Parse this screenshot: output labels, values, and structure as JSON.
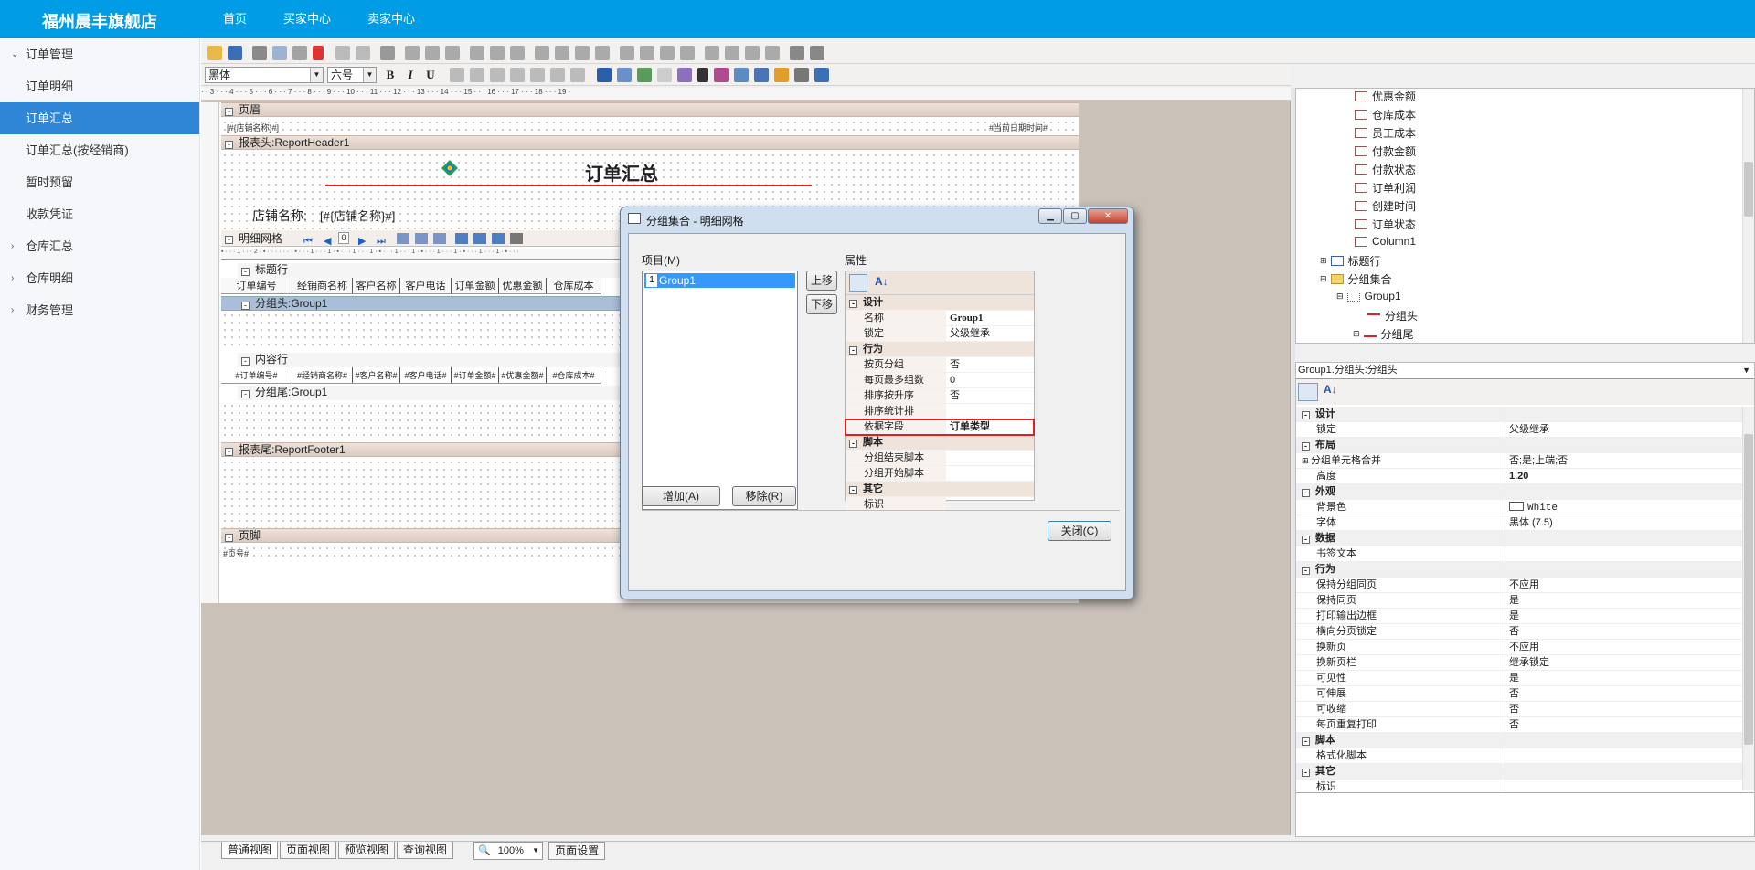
{
  "app": {
    "brand": "福州晨丰旗舰店"
  },
  "topnav": [
    "首页",
    "买家中心",
    "卖家中心"
  ],
  "sidebar": [
    {
      "label": "订单管理",
      "type": "group",
      "expanded": true
    },
    {
      "label": "订单明细",
      "type": "child"
    },
    {
      "label": "订单汇总",
      "type": "child",
      "active": true
    },
    {
      "label": "订单汇总(按经销商)",
      "type": "child"
    },
    {
      "label": "暂时预留",
      "type": "child"
    },
    {
      "label": "收款凭证",
      "type": "child"
    },
    {
      "label": "仓库汇总",
      "type": "group"
    },
    {
      "label": "仓库明细",
      "type": "group"
    },
    {
      "label": "财务管理",
      "type": "group"
    }
  ],
  "format_toolbar": {
    "font": "黑体",
    "size": "六号",
    "bold": "B",
    "italic": "I",
    "underline": "U"
  },
  "ruler_text": "· · 3 · · · 4 · · · 5 · · · 6 · · · 7 · · · 8 · · · 9 · · · 10 · · · 11 · · · 12 · · · 13 · · · 14 · · · 15 · · · 16 · · · 17 · · · 18 · · · 19 ·",
  "report": {
    "page_header": "页眉",
    "store_field": "[#{店铺名称}#]",
    "date_field": "#当前日期时间#",
    "report_header": "报表头:ReportHeader1",
    "title": "订单汇总",
    "store_label": "店铺名称:",
    "store_value": "[#{店铺名称}#]",
    "grid_label": "明细网格",
    "grid_page": "0",
    "title_row": "标题行",
    "columns": [
      "订单编号",
      "经销商名称",
      "客户名称",
      "客户电话",
      "订单金额",
      "优惠金额",
      "仓库成本"
    ],
    "group_header": "分组头:Group1",
    "content_row": "内容行",
    "content_fields": [
      "#订单编号#",
      "#经销商名称#",
      "#客户名称#",
      "#客户电话#",
      "#订单金额#",
      "#优惠金额#",
      "#仓库成本#"
    ],
    "group_footer": "分组尾:Group1",
    "report_footer": "报表尾:ReportFooter1",
    "page_footer": "页脚",
    "page_no": "#页号#"
  },
  "bottom_tabs": [
    "普通视图",
    "页面视图",
    "预览视图",
    "查询视图"
  ],
  "zoom": "100%",
  "page_setup": "页面设置",
  "tree": {
    "items": [
      {
        "label": "优惠金额",
        "level": 3
      },
      {
        "label": "仓库成本",
        "level": 3
      },
      {
        "label": "员工成本",
        "level": 3
      },
      {
        "label": "付款金额",
        "level": 3
      },
      {
        "label": "付款状态",
        "level": 3
      },
      {
        "label": "订单利润",
        "level": 3
      },
      {
        "label": "创建时间",
        "level": 3
      },
      {
        "label": "订单状态",
        "level": 3
      },
      {
        "label": "Column1",
        "level": 3
      },
      {
        "label": "标题行",
        "level": 1
      },
      {
        "label": "分组集合",
        "level": 1
      },
      {
        "label": "Group1",
        "level": 2
      },
      {
        "label": "分组头",
        "level": 3
      },
      {
        "label": "分组尾",
        "level": 3
      }
    ]
  },
  "props_panel": {
    "combo": "Group1.分组头:分组头",
    "rows": [
      {
        "cat": "设计"
      },
      {
        "k": "锁定",
        "v": "父级继承"
      },
      {
        "cat": "布局"
      },
      {
        "k": "分组单元格合并",
        "v": "否;是;上端;否",
        "expand": true
      },
      {
        "k": "高度",
        "v": "1.20",
        "bold": true
      },
      {
        "cat": "外观"
      },
      {
        "k": "背景色",
        "v": "White",
        "swatch": true
      },
      {
        "k": "字体",
        "v": "黑体 (7.5)"
      },
      {
        "cat": "数据"
      },
      {
        "k": "书签文本",
        "v": ""
      },
      {
        "cat": "行为"
      },
      {
        "k": "保持分组同页",
        "v": "不应用"
      },
      {
        "k": "保持同页",
        "v": "是"
      },
      {
        "k": "打印输出边框",
        "v": "是"
      },
      {
        "k": "横向分页锁定",
        "v": "否"
      },
      {
        "k": "换新页",
        "v": "不应用"
      },
      {
        "k": "换新页栏",
        "v": "继承锁定"
      },
      {
        "k": "可见性",
        "v": "是"
      },
      {
        "k": "可伸展",
        "v": "否"
      },
      {
        "k": "可收缩",
        "v": "否"
      },
      {
        "k": "每页重复打印",
        "v": "否"
      },
      {
        "cat": "脚本"
      },
      {
        "k": "格式化脚本",
        "v": ""
      },
      {
        "cat": "其它"
      },
      {
        "k": "标识",
        "v": ""
      }
    ]
  },
  "dialog": {
    "title": "分组集合 - 明细网格",
    "items_label": "项目(M)",
    "props_label": "属性",
    "list_item_num": "1",
    "list_item": "Group1",
    "up_btn": "上移",
    "down_btn": "下移",
    "add_btn": "增加(A)",
    "remove_btn": "移除(R)",
    "close_btn": "关闭(C)",
    "rows": [
      {
        "cat": "设计"
      },
      {
        "k": "名称",
        "v": "Group1",
        "bold": true
      },
      {
        "k": "锁定",
        "v": "父级继承"
      },
      {
        "cat": "行为"
      },
      {
        "k": "按页分组",
        "v": "否"
      },
      {
        "k": "每页最多组数",
        "v": "0"
      },
      {
        "k": "排序按升序",
        "v": "否"
      },
      {
        "k": "排序统计排",
        "v": ""
      },
      {
        "k": "依据字段",
        "v": "订单类型",
        "bold": true,
        "highlight": true
      },
      {
        "cat": "脚本"
      },
      {
        "k": "分组结束脚本",
        "v": ""
      },
      {
        "k": "分组开始脚本",
        "v": ""
      },
      {
        "cat": "其它"
      },
      {
        "k": "标识",
        "v": ""
      }
    ]
  },
  "colors": {
    "topbar": "#009de6",
    "active": "#2f86d6",
    "designer_bg": "#cac1b9",
    "highlight": "#e02020"
  }
}
